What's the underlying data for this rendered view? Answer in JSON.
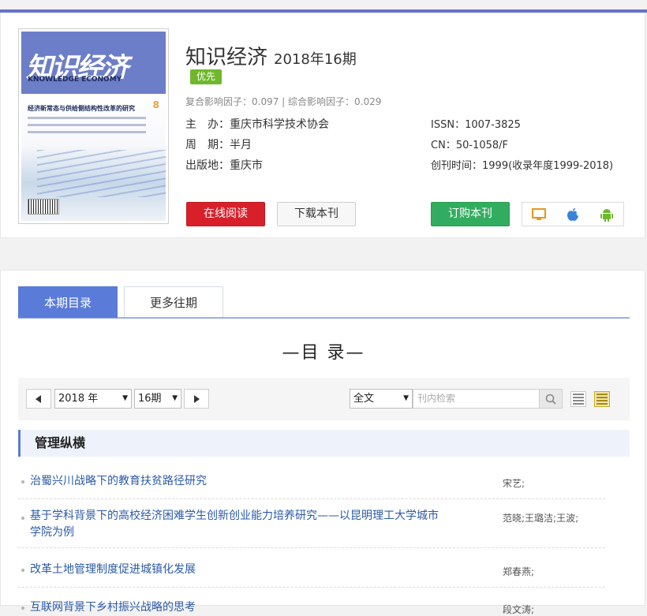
{
  "journal": {
    "name": "知识经济",
    "issue": "2018年16期",
    "badge": "优先",
    "impact": "复合影响因子：0.097 | 综合影响因子：0.029",
    "sponsor_label": "主　办：",
    "sponsor": "重庆市科学技术协会",
    "period_label": "周　期：",
    "period": "半月",
    "place_label": "出版地：",
    "place": "重庆市",
    "issn_label": "ISSN：",
    "issn": "1007-3825",
    "cn_label": "CN：",
    "cn": "50-1058/F",
    "founded_label": "创刊时间：",
    "founded": "1999(收录年度1999-2018)"
  },
  "cover": {
    "title": "知识经济",
    "subtitle": "KNOWLEDGE ECONOMY",
    "headline": "经济新常态与供给侧结构性改革的研究",
    "number": "8"
  },
  "actions": {
    "read": "在线阅读",
    "download": "下载本刊",
    "subscribe": "订购本刊"
  },
  "tabs": {
    "current": "本期目录",
    "more": "更多往期"
  },
  "toc_title": "—目 录—",
  "filter": {
    "year": "2018 年",
    "issue": "16期",
    "scope": "全文",
    "search_placeholder": "刊内检索"
  },
  "section": "管理纵横",
  "articles": [
    {
      "title": "治蜀兴川战略下的教育扶贫路径研究",
      "authors": "宋艺;"
    },
    {
      "title": "基于学科背景下的高校经济困难学生创新创业能力培养研究——以昆明理工大学城市学院为例",
      "authors": "范晓;王璐洁;王波;"
    },
    {
      "title": "改革土地管理制度促进城镇化发展",
      "authors": "郑春燕;"
    },
    {
      "title": "互联网背景下乡村振兴战略的思考",
      "authors": "段文涛;"
    }
  ],
  "colors": {
    "accent": "#5a7bd7",
    "red": "#d8202b",
    "green": "#32ad5f",
    "badge": "#6fb82b",
    "link": "#2b5aa8"
  }
}
